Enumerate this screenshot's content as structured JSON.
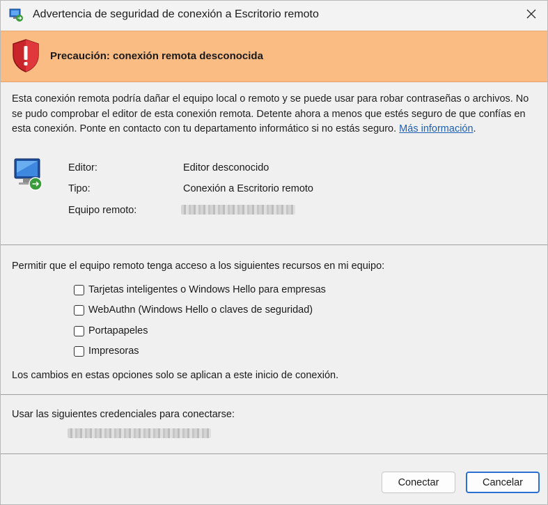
{
  "window": {
    "title": "Advertencia de seguridad de conexión a Escritorio remoto"
  },
  "banner": {
    "title": "Precaución: conexión remota desconocida"
  },
  "description": {
    "text": "Esta conexión remota podría dañar el equipo local o remoto y se puede usar para robar contraseñas o archivos. No se pudo comprobar el editor de esta conexión remota. Detente ahora a menos que estés seguro de que confías en esta conexión. Ponte en contacto con tu departamento informático si no estás seguro. ",
    "link": "Más información",
    "suffix": "."
  },
  "info": {
    "editor_label": "Editor:",
    "editor_value": "Editor desconocido",
    "type_label": "Tipo:",
    "type_value": "Conexión a Escritorio remoto",
    "remote_label": "Equipo remoto:"
  },
  "resources": {
    "heading": "Permitir que el equipo remoto tenga acceso a los siguientes recursos en mi equipo:",
    "options": [
      {
        "label": "Tarjetas inteligentes o Windows Hello para empresas",
        "checked": false
      },
      {
        "label": "WebAuthn (Windows Hello o claves de seguridad)",
        "checked": false
      },
      {
        "label": "Portapapeles",
        "checked": false
      },
      {
        "label": "Impresoras",
        "checked": false
      }
    ],
    "note": "Los cambios en estas opciones solo se aplican a este inicio de conexión."
  },
  "credentials": {
    "heading": "Usar las siguientes credenciales para conectarse:"
  },
  "buttons": {
    "connect": "Conectar",
    "cancel": "Cancelar"
  },
  "colors": {
    "banner_background": "#fbbc84",
    "link": "#1f5fb3",
    "primary_button_border": "#2a6fd1"
  },
  "icons": {
    "app": "remote-desktop-icon",
    "close": "close-icon",
    "warning": "warning-shield-icon",
    "computer": "remote-computer-icon"
  }
}
